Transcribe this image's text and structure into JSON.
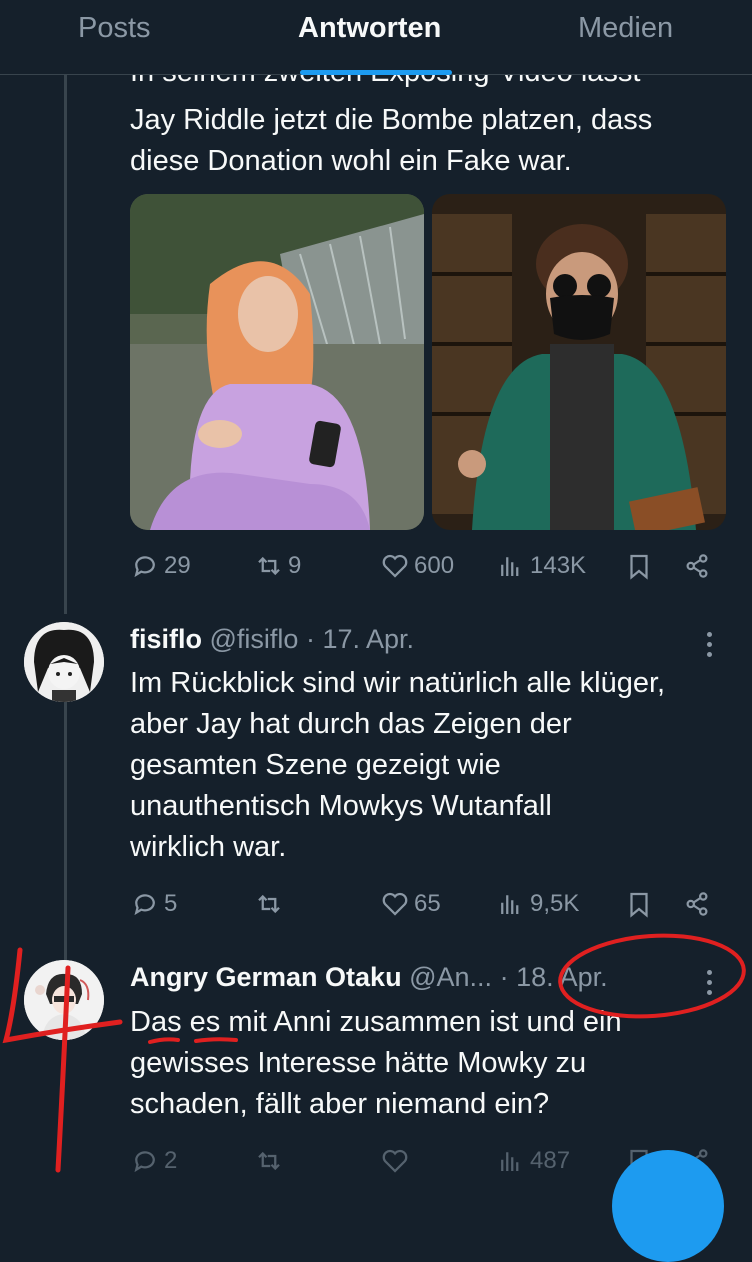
{
  "tabs": [
    {
      "label": "Posts"
    },
    {
      "label": "Antworten"
    },
    {
      "label": "Medien"
    }
  ],
  "tweet1": {
    "cut_line": "In seinem zweiten Exposing-Video lässt",
    "text": "Jay Riddle jetzt die Bombe platzen, dass\ndiese Donation wohl ein Fake war.",
    "stats": {
      "replies": "29",
      "reposts": "9",
      "likes": "600",
      "views": "143K"
    }
  },
  "tweet2": {
    "name": "fisiflo",
    "handle": "@fisiflo",
    "date": "17. Apr.",
    "text": "Im Rückblick sind wir natürlich alle klüger,\naber Jay hat durch das Zeigen der\ngesamten Szene gezeigt wie\nunauthentisch Mowkys Wutanfall\nwirklich war.",
    "stats": {
      "replies": "5",
      "reposts": "",
      "likes": "65",
      "views": "9,5K"
    }
  },
  "tweet3": {
    "name": "Angry German Otaku",
    "handle": "@An...",
    "date": "18. Apr.",
    "text": "Das es mit Anni zusammen ist und ein\ngewisses Interesse hätte Mowky zu\nschaden, fällt aber niemand ein?",
    "stats": {
      "replies": "2",
      "reposts": "",
      "likes": "",
      "views": "487"
    }
  },
  "separator": "·",
  "colors": {
    "background": "#15202b",
    "accent": "#1d9bf0",
    "secondary_text": "#8b98a5",
    "annotation": "#e02020"
  }
}
